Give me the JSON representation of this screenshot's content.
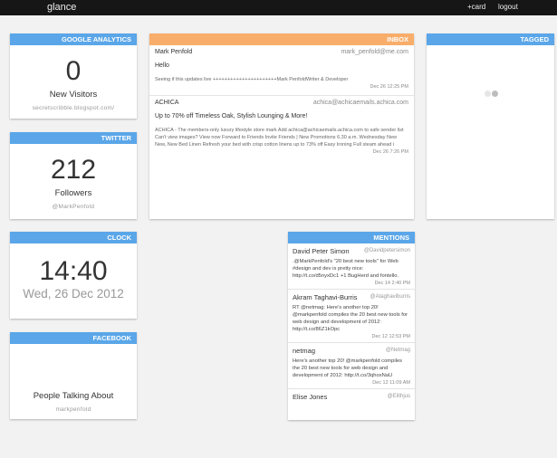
{
  "topbar": {
    "brand": "glance",
    "add_card": "+card",
    "logout": "logout"
  },
  "analytics": {
    "title": "GOOGLE ANALYTICS",
    "value": "0",
    "label": "New Visitors",
    "site": "secretscribble.blogspot.com/"
  },
  "twitter": {
    "title": "TWITTER",
    "value": "212",
    "label": "Followers",
    "handle": "@MarkPenfold"
  },
  "clock": {
    "title": "CLOCK",
    "time": "14:40",
    "date": "Wed, 26 Dec 2012"
  },
  "facebook": {
    "title": "FACEBOOK",
    "label": "People Talking About",
    "handle": "markpenfold"
  },
  "inbox": {
    "title": "INBOX",
    "messages": [
      {
        "from": "Mark Penfold",
        "email": "mark_penfold@me.com",
        "subject": "Hello",
        "preview": "Seeing if this updates live ++++++++++++++++++++++Mark PenfoldWriter & Developer",
        "date": "Dec 26 12:25 PM"
      },
      {
        "from": "ACHICA",
        "email": "achica@achicaemails.achica.com",
        "subject": "Up to 70% off Timeless Oak, Stylish Lounging & More!",
        "preview": "ACHICA - The members-only luxury lifestyle store mark Add achica@achicaemails.achica.com to safe sender list Can't view images? View now Forward to Friends Invite Friends | New Promotions 6.30 a.m. Wednesday New New, New Bed Linen Refresh your bed with crisp cotton linens up to 73% off Easy Ironing Full steam ahead i",
        "date": "Dec 26 7:26 PM"
      }
    ]
  },
  "tagged": {
    "title": "TAGGED"
  },
  "mentions": {
    "title": "MENTIONS",
    "items": [
      {
        "name": "David Peter Simon",
        "handle": "@Davidpetersimon",
        "text": ".@MarkPenfold's \"20 best new tools\" for Web #design and dev is pretty nice: http://t.co/d5nyxDc1 +1 BugHerd and fontello.",
        "time": "Dec 14 2:40 PM"
      },
      {
        "name": "Akram Taghavi-Burris",
        "handle": "@Ataghaviburris",
        "text": "RT @netmag: Here's another top 20! @markpenfold compiles the 20 best new tools for web design and development of 2012: http://t.co/86Z1kOpc",
        "time": "Dec 12 12:53 PM"
      },
      {
        "name": "netmag",
        "handle": "@Netmag",
        "text": "Here's another top 20! @markpenfold compiles the 20 best new tools for web design and development of 2012: http://t.co/3qhoxNaU",
        "time": "Dec 12 11:09 AM"
      },
      {
        "name": "Elise Jones",
        "handle": "@Elithjus",
        "text": "",
        "time": ""
      }
    ]
  }
}
